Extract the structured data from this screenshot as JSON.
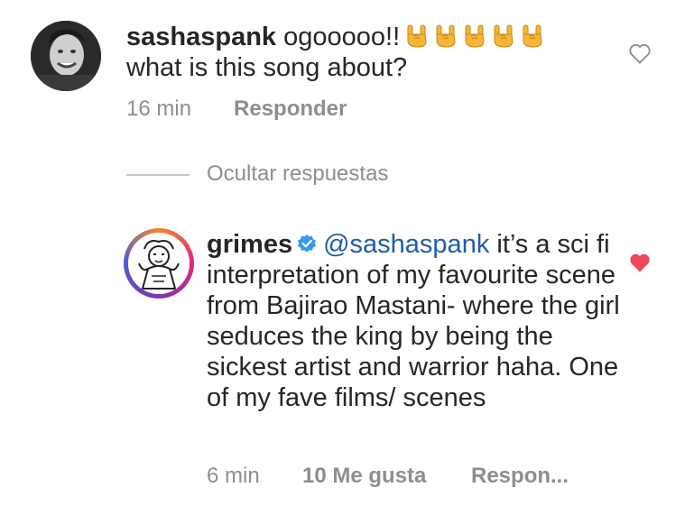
{
  "comment1": {
    "username": "sashaspank",
    "text_line1": "ogooooo!!",
    "emoji_count": 5,
    "emoji_icon": "rock-on-hand-icon",
    "text_line2": "what is this song about?",
    "time": "16 min",
    "reply_label": "Responder",
    "liked": false
  },
  "replies_toggle": {
    "label": "Ocultar respuestas"
  },
  "comment2": {
    "username": "grimes",
    "verified": true,
    "mention": "@sashaspank",
    "text": "it’s a sci fi interpretation of my favourite scene from Bajirao Mastani- where the girl seduces the king by being the sickest artist and warrior haha.  One of my fave films/ scenes",
    "time": "6 min",
    "likes": "10 Me gusta",
    "reply_label": "Respon...",
    "liked": true
  },
  "colors": {
    "text": "#262626",
    "muted": "#8e8e8e",
    "mention": "#1e5ea8",
    "verified": "#3897f0",
    "like_red": "#ed4956"
  }
}
